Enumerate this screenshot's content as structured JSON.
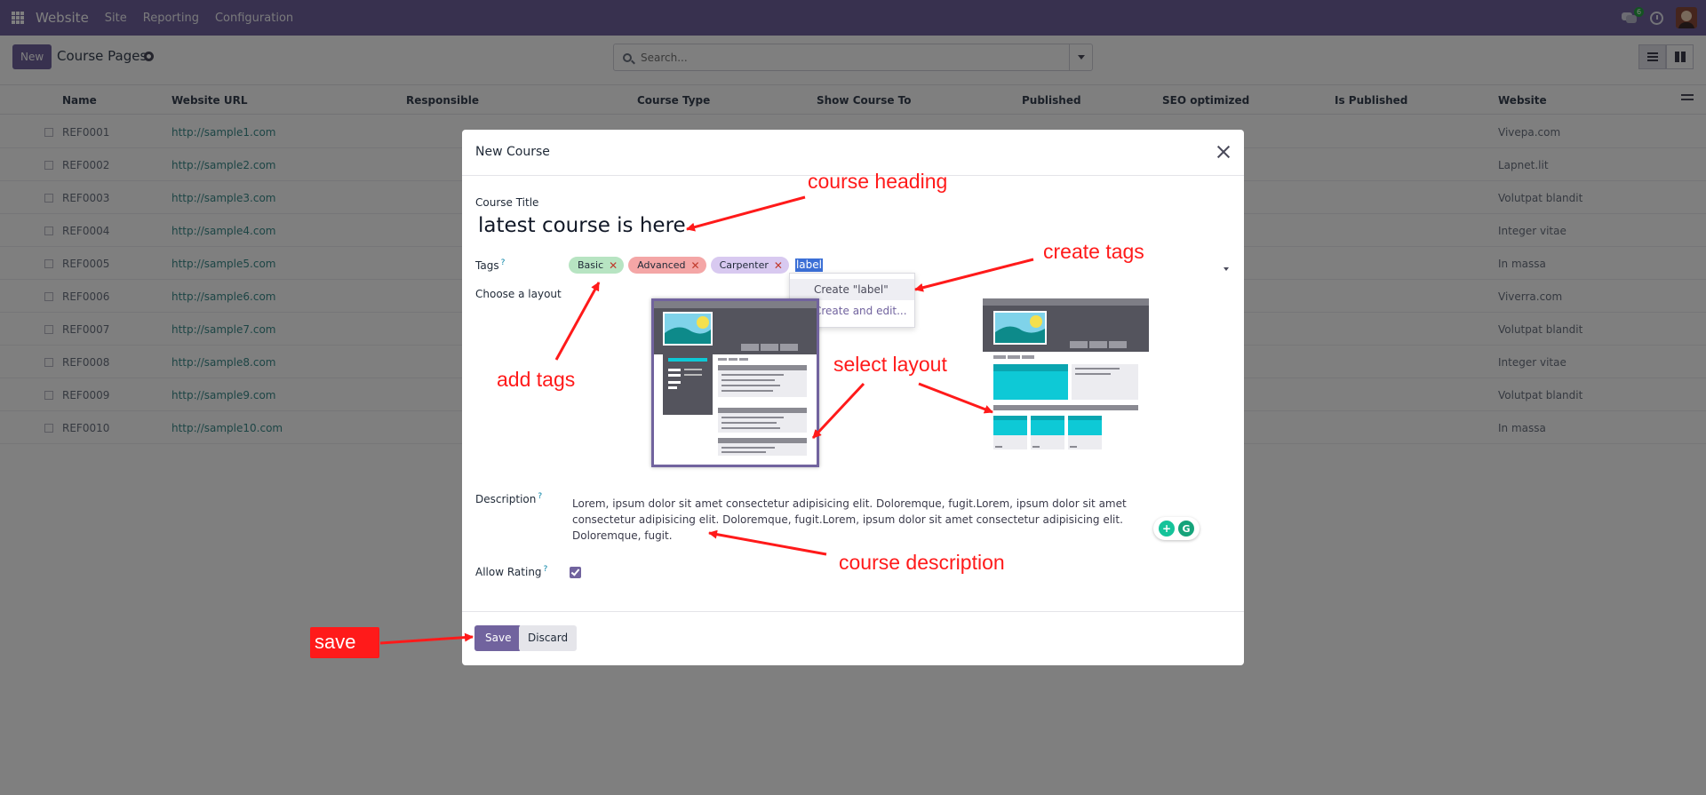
{
  "navbar": {
    "brand": "Website",
    "menu": [
      "Site",
      "Reporting",
      "Configuration"
    ],
    "chat_badge": "6"
  },
  "control": {
    "new_label": "New",
    "page_title": "Course Pages",
    "search_placeholder": "Search..."
  },
  "list": {
    "columns": [
      "Name",
      "Website URL",
      "Responsible",
      "Course Type",
      "Show Course To",
      "Published",
      "SEO optimized",
      "Is Published",
      "Website"
    ],
    "rows": [
      {
        "name": "REF0001",
        "url": "http://sample1.com",
        "website": "Vivepa.com"
      },
      {
        "name": "REF0002",
        "url": "http://sample2.com",
        "website": "Lapnet.lit"
      },
      {
        "name": "REF0003",
        "url": "http://sample3.com",
        "website": "Volutpat blandit"
      },
      {
        "name": "REF0004",
        "url": "http://sample4.com",
        "website": "Integer vitae"
      },
      {
        "name": "REF0005",
        "url": "http://sample5.com",
        "website": "In massa"
      },
      {
        "name": "REF0006",
        "url": "http://sample6.com",
        "website": "Viverra.com"
      },
      {
        "name": "REF0007",
        "url": "http://sample7.com",
        "website": "Volutpat blandit"
      },
      {
        "name": "REF0008",
        "url": "http://sample8.com",
        "website": "Integer vitae"
      },
      {
        "name": "REF0009",
        "url": "http://sample9.com",
        "website": "Volutpat blandit"
      },
      {
        "name": "REF0010",
        "url": "http://sample10.com",
        "website": "In massa"
      }
    ]
  },
  "modal": {
    "title": "New Course",
    "course_title_label": "Course Title",
    "course_title_value": "latest course is here",
    "tags_label": "Tags",
    "tags": [
      "Basic",
      "Advanced",
      "Carpenter"
    ],
    "tag_input_value": "label",
    "dropdown": [
      "Create \"label\"",
      "Create and edit..."
    ],
    "layout_label": "Choose a layout",
    "description_label": "Description",
    "description_text": "Lorem, ipsum dolor sit amet consectetur adipisicing elit. Doloremque, fugit.Lorem, ipsum dolor sit amet consectetur adipisicing elit. Doloremque, fugit.Lorem, ipsum dolor sit amet consectetur adipisicing elit. Doloremque, fugit.",
    "allow_rating_label": "Allow Rating",
    "help_mark": "?",
    "save_label": "Save",
    "discard_label": "Discard"
  },
  "annotations": {
    "course_heading": "course heading",
    "create_tags": "create tags",
    "add_tags": "add tags",
    "select_layout": "select layout",
    "course_description": "course description",
    "save": "save"
  },
  "colors": {
    "primary": "#71639e",
    "annotation": "#ff1a1a"
  }
}
